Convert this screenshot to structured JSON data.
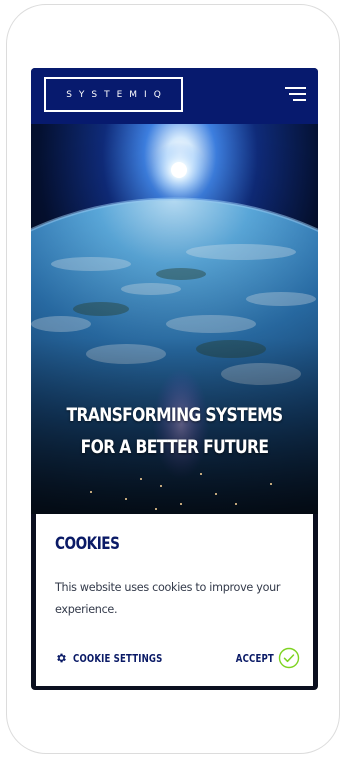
{
  "header": {
    "logo_text": "SYSTEMIQ",
    "menu_icon": "hamburger-menu-icon"
  },
  "hero": {
    "title_line1": "TRANSFORMING SYSTEMS",
    "title_line2": "FOR A BETTER FUTURE",
    "background": "earth-from-space-image"
  },
  "cookie_banner": {
    "title": "COOKIES",
    "message": "This website uses cookies to improve your experience.",
    "settings_label": "COOKIE SETTINGS",
    "settings_icon": "gear-icon",
    "accept_label": "ACCEPT",
    "accept_icon": "check-circle-icon"
  },
  "colors": {
    "brand_navy": "#071a6e",
    "text_navy": "#0a1a66",
    "accept_green": "#7ed321"
  }
}
